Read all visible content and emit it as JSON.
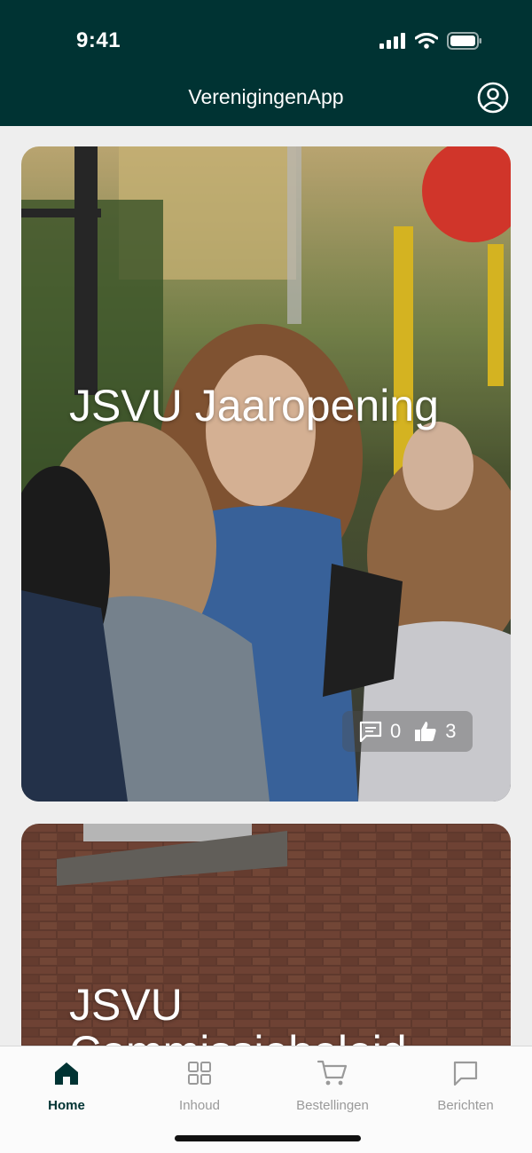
{
  "status_bar": {
    "time": "9:41",
    "icons": [
      "signal-icon",
      "wifi-icon",
      "battery-icon"
    ]
  },
  "header": {
    "title": "VerenigingenApp",
    "profile_icon": "account-circle-icon"
  },
  "feed": [
    {
      "title": "JSVU Jaaropening",
      "comments": "0",
      "likes": "3"
    },
    {
      "title": "JSVU Commissiebeleid"
    }
  ],
  "tabs": [
    {
      "label": "Home",
      "icon": "home-icon",
      "active": true
    },
    {
      "label": "Inhoud",
      "icon": "grid-icon",
      "active": false
    },
    {
      "label": "Bestellingen",
      "icon": "cart-icon",
      "active": false
    },
    {
      "label": "Berichten",
      "icon": "message-icon",
      "active": false
    }
  ],
  "colors": {
    "header_bg": "#003333",
    "active_tab": "#003333",
    "inactive_tab": "#9a9a9a",
    "background": "#eeeeee"
  }
}
